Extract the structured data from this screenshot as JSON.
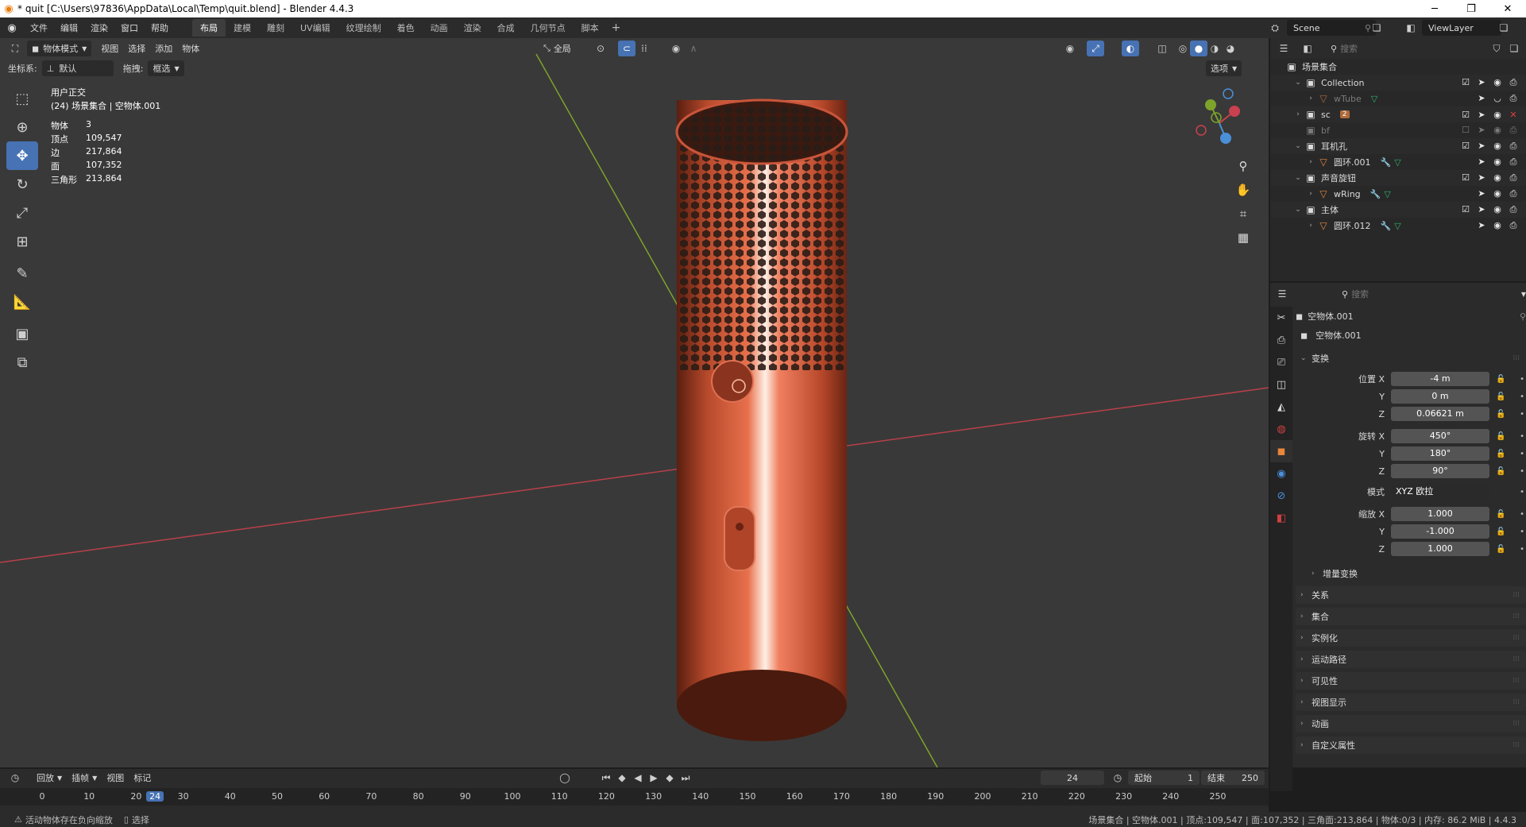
{
  "window": {
    "title": "* quit [C:\\Users\\97836\\AppData\\Local\\Temp\\quit.blend] - Blender 4.4.3",
    "controls": [
      "─",
      "❐",
      "✕"
    ]
  },
  "menubar": {
    "menus": [
      "文件",
      "编辑",
      "渲染",
      "窗口",
      "帮助"
    ],
    "workspaces": [
      "布局",
      "建模",
      "雕刻",
      "UV编辑",
      "纹理绘制",
      "着色",
      "动画",
      "渲染",
      "合成",
      "几何节点",
      "脚本"
    ],
    "active_workspace": "布局",
    "add_tab": "+",
    "scene": "Scene",
    "view_layer": "ViewLayer"
  },
  "viewport": {
    "mode": "物体模式",
    "menus": [
      "视图",
      "选择",
      "添加",
      "物体"
    ],
    "transform_global": "全局",
    "coord_label": "坐标系:",
    "coord_value": "默认",
    "drag_label": "拖拽:",
    "drag_value": "框选",
    "options": "选项",
    "view_name": "用户正交",
    "context": "(24) 场景集合 | 空物体.001",
    "stats": [
      {
        "k": "物体",
        "v": "3"
      },
      {
        "k": "顶点",
        "v": "109,547"
      },
      {
        "k": "边",
        "v": "217,864"
      },
      {
        "k": "面",
        "v": "107,352"
      },
      {
        "k": "三角形",
        "v": "213,864"
      }
    ],
    "colors": {
      "x_axis": "#c9414e",
      "y_axis": "#7fa12b",
      "object": "#e0603e"
    }
  },
  "outliner": {
    "search_placeholder": "搜索",
    "root": "场景集合",
    "rows": [
      {
        "label": "Collection",
        "depth": 1,
        "type": "collection",
        "expand": "⌄",
        "checked": true,
        "dim": false
      },
      {
        "label": "wTube",
        "depth": 2,
        "type": "mesh",
        "expand": "›",
        "checked": false,
        "dim": true
      },
      {
        "label": "sc",
        "depth": 1,
        "type": "collection",
        "expand": "›",
        "checked": true,
        "dim": false,
        "badge": "2"
      },
      {
        "label": "bf",
        "depth": 1,
        "type": "collection",
        "expand": "",
        "checked": false,
        "dim": true
      },
      {
        "label": "耳机孔",
        "depth": 1,
        "type": "collection",
        "expand": "⌄",
        "checked": true,
        "dim": false
      },
      {
        "label": "圆环.001",
        "depth": 2,
        "type": "mesh",
        "expand": "›",
        "checked": false,
        "dim": false
      },
      {
        "label": "声音旋钮",
        "depth": 1,
        "type": "collection",
        "expand": "⌄",
        "checked": true,
        "dim": false
      },
      {
        "label": "wRing",
        "depth": 2,
        "type": "mesh",
        "expand": "›",
        "checked": false,
        "dim": false
      },
      {
        "label": "主体",
        "depth": 1,
        "type": "collection",
        "expand": "⌄",
        "checked": true,
        "dim": false
      },
      {
        "label": "圆环.012",
        "depth": 2,
        "type": "mesh",
        "expand": "›",
        "checked": false,
        "dim": false
      }
    ]
  },
  "properties": {
    "search_placeholder": "搜索",
    "object_name": "空物体.001",
    "datablock": "空物体.001",
    "transform_title": "变换",
    "location": {
      "label": "位置 X",
      "x": "-4 m",
      "y": "0 m",
      "z": "0.06621 m"
    },
    "rotation": {
      "label": "旋转 X",
      "x": "450°",
      "y": "180°",
      "z": "90°"
    },
    "rotation_mode": {
      "label": "模式",
      "value": "XYZ 欧拉"
    },
    "scale": {
      "label": "缩放 X",
      "x": "1.000",
      "y": "-1.000",
      "z": "1.000"
    },
    "axis_y": "Y",
    "axis_z": "Z",
    "delta": "增量变换",
    "sections": [
      "关系",
      "集合",
      "实例化",
      "运动路径",
      "可见性",
      "视图显示",
      "动画",
      "自定义属性"
    ]
  },
  "timeline": {
    "menus": [
      "回放",
      "插帧",
      "视图",
      "标记"
    ],
    "current_frame": "24",
    "start_label": "起始",
    "start": "1",
    "end_label": "结束",
    "end": "250",
    "ticks": [
      "0",
      "10",
      "20",
      "30",
      "40",
      "50",
      "60",
      "70",
      "80",
      "90",
      "100",
      "110",
      "120",
      "130",
      "140",
      "150",
      "160",
      "170",
      "180",
      "190",
      "200",
      "210",
      "220",
      "230",
      "240",
      "250"
    ]
  },
  "statusbar": {
    "warning": "活动物体存在负向缩放",
    "select": "选择",
    "info": "场景集合 | 空物体.001 | 顶点:109,547 | 面:107,352 | 三角面:213,864 | 物体:0/3 | 内存: 86.2 MiB | 4.4.3"
  }
}
